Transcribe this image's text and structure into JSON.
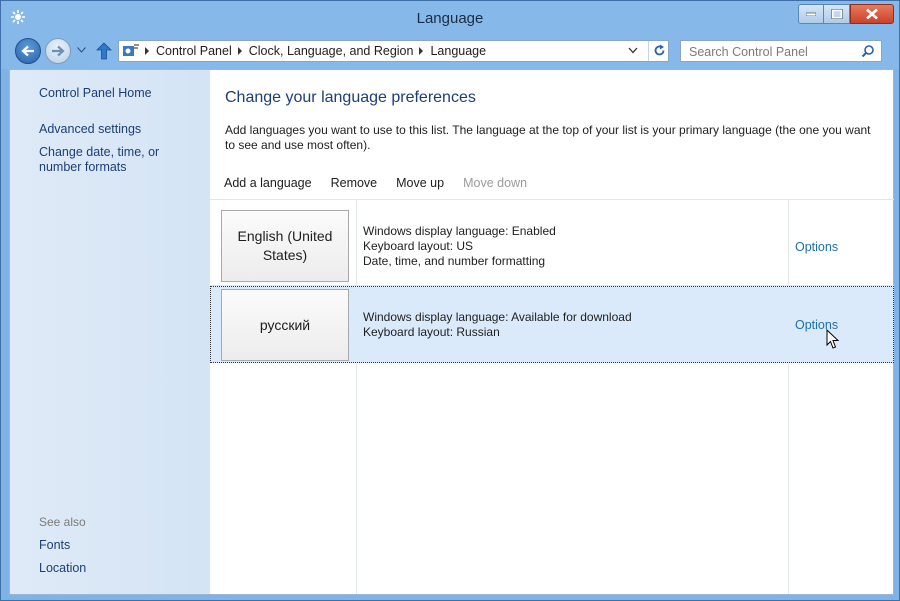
{
  "window": {
    "title": "Language"
  },
  "titlebar_icons": {
    "app": "control-panel-icon",
    "minimize": "minimize-icon",
    "maximize": "maximize-icon",
    "close": "close-icon"
  },
  "nav": {
    "breadcrumb": [
      "Control Panel",
      "Clock, Language, and Region",
      "Language"
    ],
    "search_placeholder": "Search Control Panel"
  },
  "sidebar": {
    "home": "Control Panel Home",
    "links": [
      "Advanced settings",
      "Change date, time, or number formats"
    ],
    "see_also_title": "See also",
    "see_also": [
      "Fonts",
      "Location"
    ]
  },
  "main": {
    "heading": "Change your language preferences",
    "description": "Add languages you want to use to this list. The language at the top of your list is your primary language (the one you want to see and use most often).",
    "toolbar": {
      "add": "Add a language",
      "remove": "Remove",
      "move_up": "Move up",
      "move_down": "Move down"
    },
    "languages": [
      {
        "name": "English (United States)",
        "details": [
          "Windows display language: Enabled",
          "Keyboard layout: US",
          "Date, time, and number formatting"
        ],
        "options": "Options"
      },
      {
        "name": "русский",
        "details": [
          "Windows display language: Available for download",
          "Keyboard layout: Russian"
        ],
        "options": "Options"
      }
    ]
  },
  "colors": {
    "accent": "#1e3e74",
    "link": "#1f6fae",
    "selected_row": "#dbeafb",
    "frame": "#86b9ea"
  }
}
